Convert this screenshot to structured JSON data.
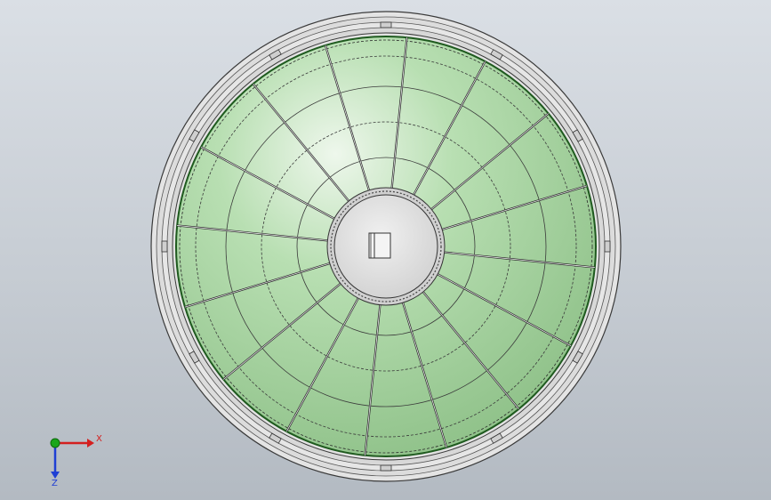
{
  "triad": {
    "x_label": "X",
    "z_label": "Z",
    "x_color": "#d41f1f",
    "z_color": "#1f3fd4",
    "y_color": "#1aa61a"
  },
  "model": {
    "name": "circular-dome-roof",
    "panel_fill": "#9fd49a",
    "rim_fill": "#e3e3e3",
    "hub_fill": "#dcdcdc",
    "edge_color": "#2a2a2a",
    "rib_count": 16,
    "center_icon": "hatch-rectangle-icon"
  }
}
